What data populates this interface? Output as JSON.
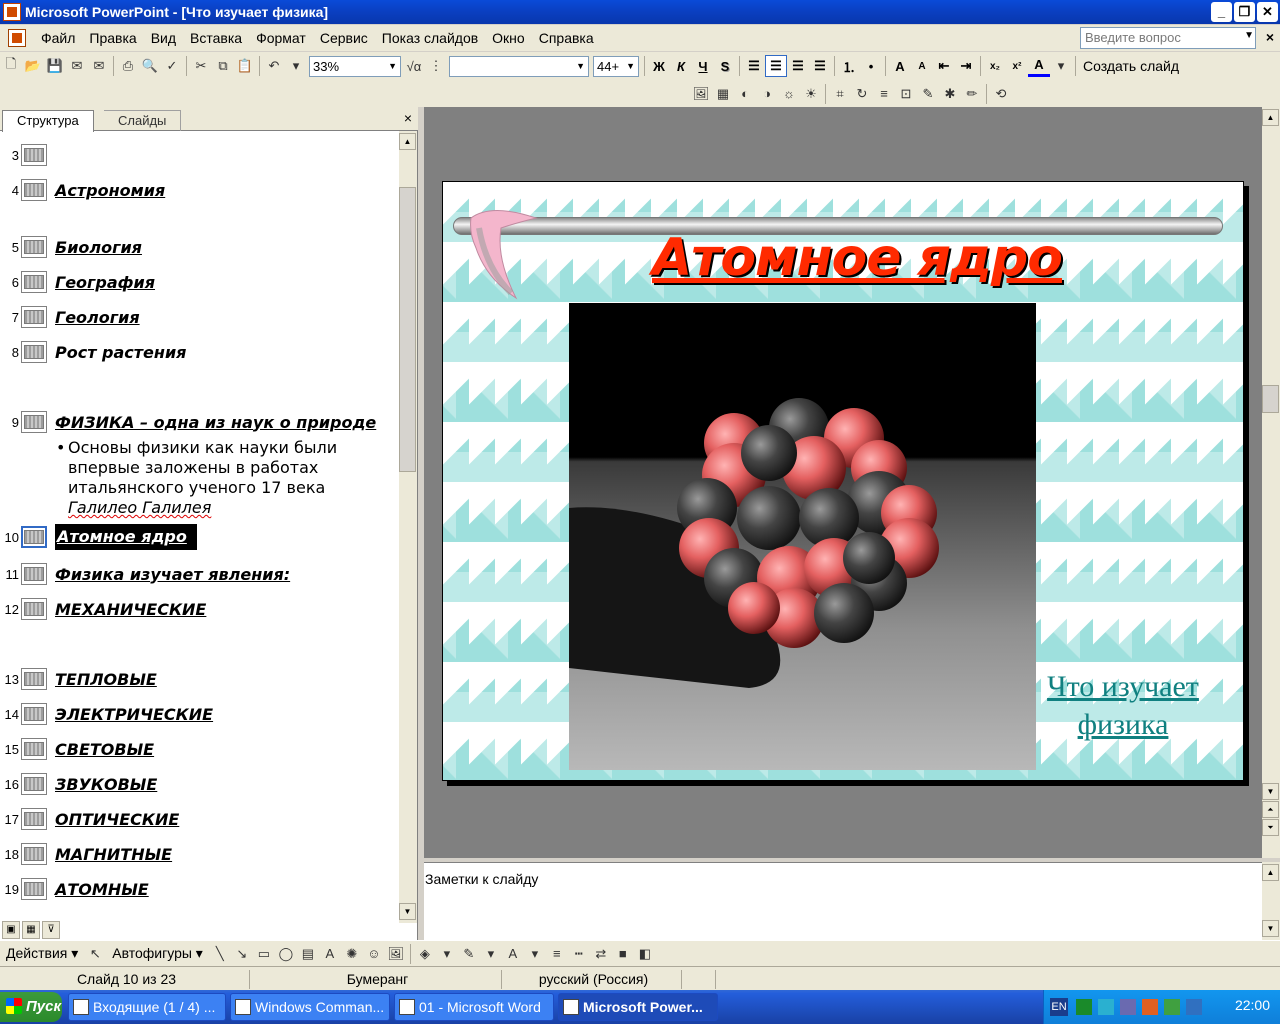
{
  "window": {
    "title": "Microsoft PowerPoint - [Что изучает физика]",
    "buttons": [
      "_",
      "❐",
      "✕"
    ]
  },
  "menu": {
    "items": [
      "Файл",
      "Правка",
      "Вид",
      "Вставка",
      "Формат",
      "Сервис",
      "Показ слайдов",
      "Окно",
      "Справка"
    ],
    "ask_placeholder": "Введите вопрос"
  },
  "toolbar": {
    "zoom": "33%",
    "font_name": "",
    "font_size": "44+",
    "bold": "Ж",
    "italic": "К",
    "underline": "Ч",
    "shadow": "S",
    "new_slide": "Создать слайд"
  },
  "outline_pane": {
    "tabs": [
      "Структура",
      "Слайды"
    ],
    "items": [
      {
        "num": "3",
        "title": ""
      },
      {
        "num": "4",
        "title": "Астрономия"
      },
      {
        "num": "5",
        "title": "Биология"
      },
      {
        "num": "6",
        "title": "География"
      },
      {
        "num": "7",
        "title": "Геология"
      },
      {
        "num": "8",
        "title": "Рост растения"
      },
      {
        "num": "9",
        "title": "ФИЗИКА – одна из наук о природе"
      },
      {
        "num": "10",
        "title": "Атомное ядро"
      },
      {
        "num": "11",
        "title": "Физика изучает явления:"
      },
      {
        "num": "12",
        "title": "МЕХАНИЧЕСКИЕ"
      },
      {
        "num": "13",
        "title": "ТЕПЛОВЫЕ"
      },
      {
        "num": "14",
        "title": "ЭЛЕКТРИЧЕСКИЕ"
      },
      {
        "num": "15",
        "title": "СВЕТОВЫЕ"
      },
      {
        "num": "16",
        "title": "ЗВУКОВЫЕ"
      },
      {
        "num": "17",
        "title": "ОПТИЧЕСКИЕ"
      },
      {
        "num": "18",
        "title": "МАГНИТНЫЕ"
      },
      {
        "num": "19",
        "title": "АТОМНЫЕ"
      }
    ],
    "bullet": {
      "text": "Основы физики как науки были впервые заложены в работах итальянского ученого 17 века ",
      "emphasis": "Галилео Галилея"
    }
  },
  "slide": {
    "title": "Атомное ядро",
    "link_line1": "Что изучает",
    "link_line2": "физика"
  },
  "notes": {
    "placeholder": "Заметки к слайду"
  },
  "drawing_toolbar": {
    "actions": "Действия",
    "autoshapes": "Автофигуры"
  },
  "status": {
    "slide": "Слайд 10 из 23",
    "design": "Бумеранг",
    "language": "русский (Россия)"
  },
  "taskbar": {
    "start": "Пуск",
    "tasks": [
      "Входящие (1 / 4) ...",
      "Windows Comman...",
      "01 - Microsoft Word",
      "Microsoft Power..."
    ],
    "lang": "EN",
    "clock": "22:00"
  }
}
